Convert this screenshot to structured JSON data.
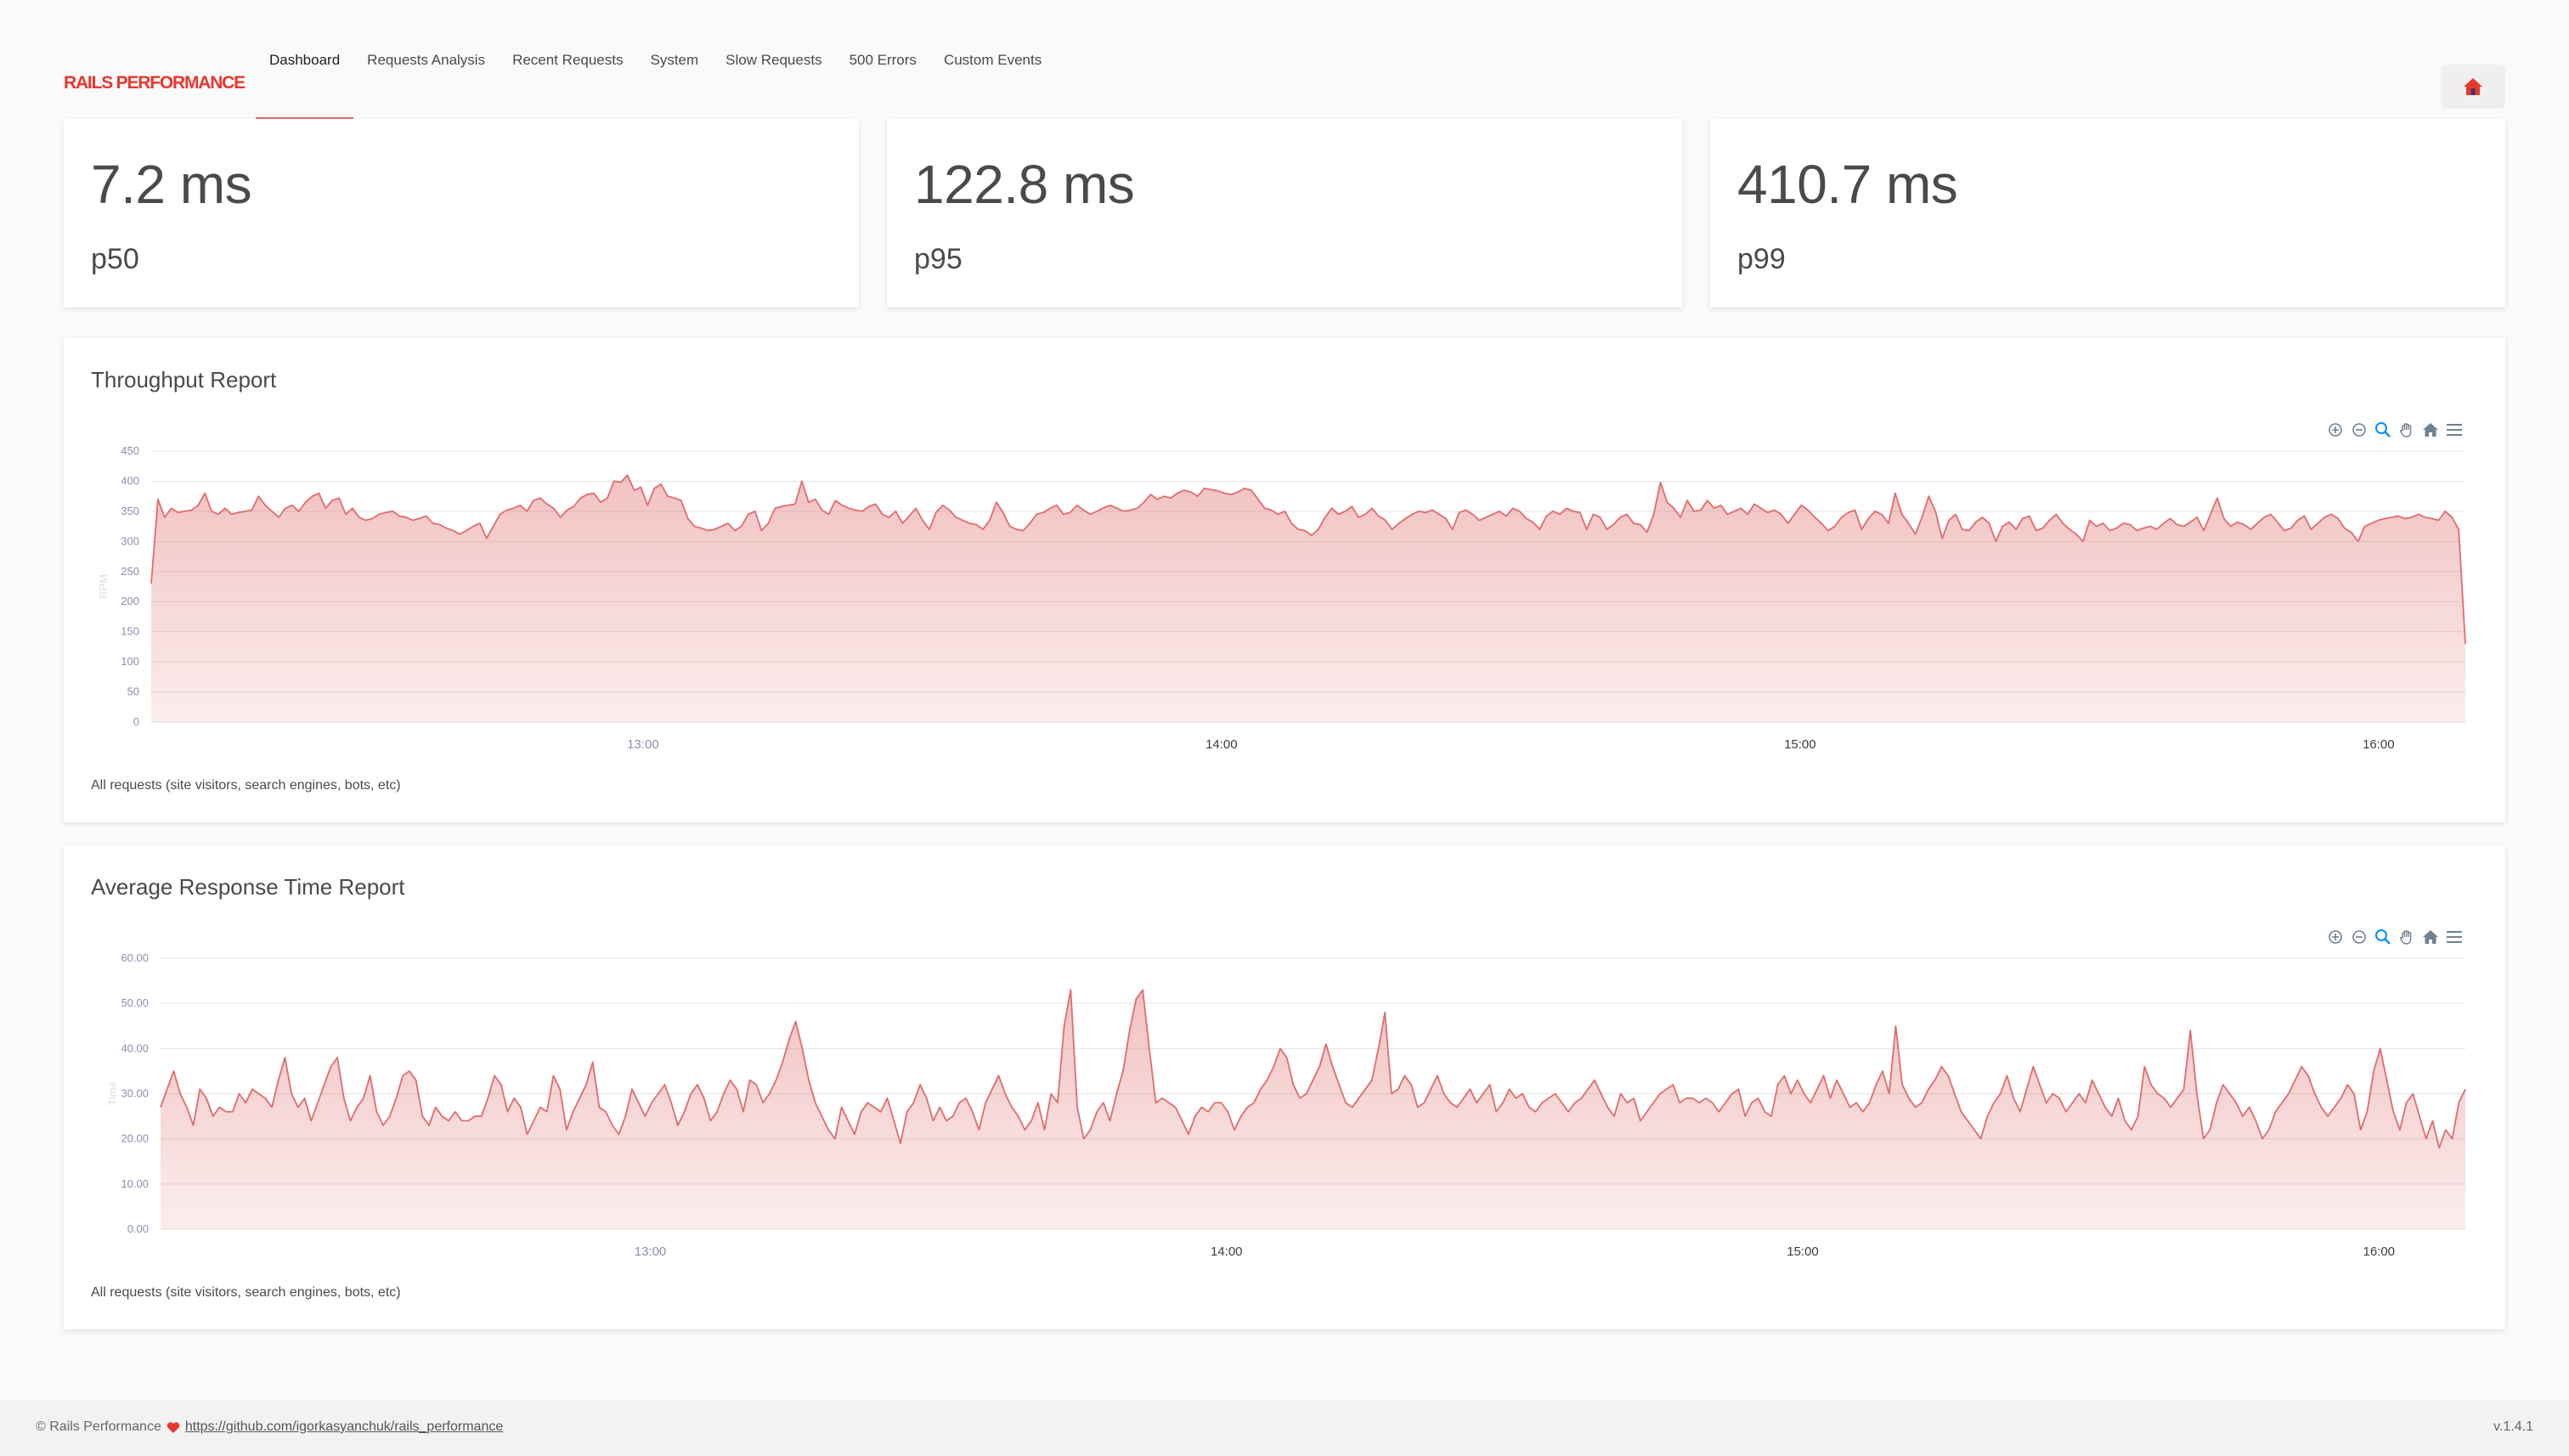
{
  "nav": {
    "brand": "RAILS PERFORMANCE",
    "tabs": [
      {
        "label": "Dashboard",
        "active": true
      },
      {
        "label": "Requests Analysis",
        "active": false
      },
      {
        "label": "Recent Requests",
        "active": false
      },
      {
        "label": "System",
        "active": false
      },
      {
        "label": "Slow Requests",
        "active": false
      },
      {
        "label": "500 Errors",
        "active": false
      },
      {
        "label": "Custom Events",
        "active": false
      }
    ],
    "home_icon": "home-icon"
  },
  "stats": [
    {
      "value": "7.2 ms",
      "label": "p50"
    },
    {
      "value": "122.8 ms",
      "label": "p95"
    },
    {
      "value": "410.7 ms",
      "label": "p99"
    }
  ],
  "throughput": {
    "title": "Throughput Report",
    "note": "All requests (site visitors, search engines, bots, etc)",
    "chart_data": {
      "type": "area",
      "ylabel": "RPM",
      "ylim": [
        0,
        450
      ],
      "yticks": [
        "450",
        "400",
        "350",
        "300",
        "250",
        "200",
        "150",
        "100",
        "50",
        "0"
      ],
      "xticks": [
        "13:00",
        "14:00",
        "15:00",
        "16:00"
      ],
      "xrange_hours": [
        12.15,
        16.15
      ],
      "color": "#e06c6c",
      "values": [
        230,
        370,
        340,
        355,
        348,
        350,
        352,
        360,
        380,
        350,
        345,
        355,
        345,
        348,
        350,
        352,
        375,
        360,
        350,
        340,
        355,
        360,
        350,
        365,
        375,
        380,
        355,
        368,
        372,
        345,
        355,
        340,
        335,
        338,
        345,
        348,
        350,
        342,
        340,
        335,
        338,
        342,
        330,
        328,
        322,
        318,
        312,
        318,
        325,
        330,
        305,
        325,
        345,
        352,
        355,
        360,
        350,
        368,
        372,
        362,
        355,
        340,
        352,
        358,
        372,
        378,
        380,
        365,
        372,
        400,
        398,
        410,
        385,
        390,
        360,
        388,
        395,
        375,
        372,
        368,
        338,
        325,
        322,
        318,
        320,
        325,
        330,
        318,
        325,
        345,
        350,
        318,
        330,
        355,
        358,
        360,
        362,
        400,
        365,
        370,
        352,
        345,
        368,
        360,
        355,
        352,
        350,
        358,
        362,
        345,
        340,
        350,
        330,
        342,
        355,
        335,
        320,
        348,
        360,
        352,
        340,
        335,
        330,
        328,
        320,
        335,
        365,
        348,
        325,
        320,
        318,
        330,
        345,
        348,
        355,
        360,
        345,
        348,
        360,
        352,
        345,
        350,
        356,
        360,
        355,
        350,
        352,
        355,
        365,
        378,
        370,
        375,
        372,
        380,
        385,
        382,
        375,
        388,
        386,
        384,
        380,
        378,
        382,
        388,
        385,
        370,
        355,
        352,
        345,
        350,
        330,
        320,
        318,
        310,
        320,
        340,
        355,
        345,
        350,
        358,
        340,
        345,
        355,
        342,
        335,
        320,
        330,
        338,
        345,
        350,
        348,
        352,
        345,
        338,
        320,
        348,
        352,
        345,
        335,
        340,
        345,
        350,
        342,
        355,
        350,
        338,
        332,
        320,
        342,
        350,
        345,
        355,
        350,
        348,
        320,
        345,
        340,
        320,
        328,
        340,
        345,
        330,
        328,
        315,
        345,
        398,
        365,
        355,
        340,
        368,
        350,
        352,
        368,
        355,
        360,
        345,
        350,
        355,
        345,
        362,
        355,
        348,
        352,
        345,
        330,
        345,
        360,
        352,
        340,
        330,
        318,
        325,
        340,
        348,
        352,
        320,
        338,
        350,
        345,
        330,
        380,
        345,
        330,
        312,
        340,
        375,
        350,
        305,
        335,
        345,
        320,
        318,
        332,
        340,
        330,
        300,
        325,
        332,
        320,
        338,
        342,
        318,
        322,
        335,
        345,
        330,
        320,
        312,
        300,
        335,
        325,
        330,
        318,
        322,
        330,
        328,
        318,
        322,
        325,
        320,
        330,
        338,
        328,
        325,
        332,
        340,
        318,
        345,
        372,
        338,
        325,
        332,
        328,
        320,
        330,
        340,
        345,
        332,
        318,
        322,
        335,
        342,
        320,
        330,
        340,
        345,
        338,
        322,
        315,
        300,
        325,
        330,
        335,
        338,
        340,
        342,
        338,
        340,
        345,
        340,
        338,
        335,
        350,
        340,
        320,
        130
      ]
    }
  },
  "response_time": {
    "title": "Average Response Time Report",
    "note": "All requests (site visitors, search engines, bots, etc)",
    "chart_data": {
      "type": "area",
      "ylabel": "Time",
      "ylim": [
        0,
        60
      ],
      "yticks": [
        "60.00",
        "50.00",
        "40.00",
        "30.00",
        "20.00",
        "10.00",
        "0.00"
      ],
      "xticks": [
        "13:00",
        "14:00",
        "15:00",
        "16:00"
      ],
      "xrange_hours": [
        12.15,
        16.15
      ],
      "color": "#e06c6c",
      "values": [
        27,
        31,
        35,
        30,
        27,
        23,
        31,
        29,
        25,
        27,
        26,
        26,
        30,
        28,
        31,
        30,
        29,
        27,
        33,
        38,
        30,
        27,
        29,
        24,
        28,
        32,
        36,
        38,
        29,
        24,
        27,
        29,
        34,
        26,
        23,
        25,
        29,
        34,
        35,
        33,
        25,
        23,
        27,
        25,
        24,
        26,
        24,
        24,
        25,
        25,
        29,
        34,
        32,
        26,
        29,
        27,
        21,
        24,
        27,
        26,
        34,
        31,
        22,
        26,
        29,
        32,
        37,
        27,
        26,
        23,
        21,
        25,
        31,
        28,
        25,
        28,
        30,
        32,
        28,
        23,
        26,
        30,
        32,
        29,
        24,
        26,
        30,
        33,
        31,
        26,
        33,
        32,
        28,
        30,
        33,
        37,
        42,
        46,
        40,
        33,
        28,
        25,
        22,
        20,
        27,
        24,
        21,
        26,
        28,
        27,
        26,
        29,
        24,
        19,
        26,
        28,
        32,
        29,
        24,
        27,
        24,
        25,
        28,
        29,
        26,
        22,
        28,
        31,
        34,
        30,
        27,
        25,
        22,
        24,
        28,
        22,
        30,
        28,
        45,
        53,
        27,
        20,
        22,
        26,
        28,
        24,
        30,
        35,
        44,
        51,
        53,
        40,
        28,
        29,
        28,
        27,
        24,
        21,
        25,
        27,
        26,
        28,
        28,
        26,
        22,
        25,
        27,
        28,
        31,
        33,
        36,
        40,
        38,
        32,
        29,
        30,
        33,
        36,
        41,
        36,
        32,
        28,
        27,
        29,
        31,
        33,
        40,
        48,
        30,
        31,
        34,
        32,
        27,
        28,
        31,
        34,
        30,
        28,
        27,
        29,
        31,
        28,
        30,
        32,
        26,
        28,
        31,
        29,
        30,
        27,
        26,
        28,
        29,
        30,
        28,
        26,
        28,
        29,
        31,
        33,
        30,
        27,
        25,
        30,
        28,
        29,
        24,
        26,
        28,
        30,
        31,
        32,
        28,
        29,
        29,
        28,
        29,
        28,
        26,
        28,
        30,
        31,
        25,
        28,
        29,
        26,
        25,
        32,
        34,
        30,
        33,
        30,
        28,
        31,
        34,
        29,
        33,
        30,
        27,
        28,
        26,
        28,
        32,
        35,
        30,
        45,
        32,
        29,
        27,
        28,
        31,
        33,
        36,
        34,
        30,
        26,
        24,
        22,
        20,
        25,
        28,
        30,
        34,
        29,
        26,
        31,
        36,
        32,
        28,
        30,
        29,
        26,
        28,
        30,
        28,
        33,
        30,
        27,
        25,
        29,
        24,
        22,
        25,
        36,
        32,
        30,
        29,
        27,
        29,
        31,
        44,
        30,
        20,
        22,
        28,
        32,
        30,
        28,
        25,
        27,
        24,
        20,
        22,
        26,
        28,
        30,
        33,
        36,
        34,
        30,
        27,
        25,
        27,
        29,
        32,
        30,
        22,
        26,
        35,
        40,
        33,
        26,
        22,
        28,
        30,
        25,
        20,
        24,
        18,
        22,
        20,
        28,
        31
      ]
    }
  },
  "footer": {
    "copyright": "© Rails Performance",
    "link": "https://github.com/igorkasyanchuk/rails_performance",
    "version": "v.1.4.1"
  }
}
